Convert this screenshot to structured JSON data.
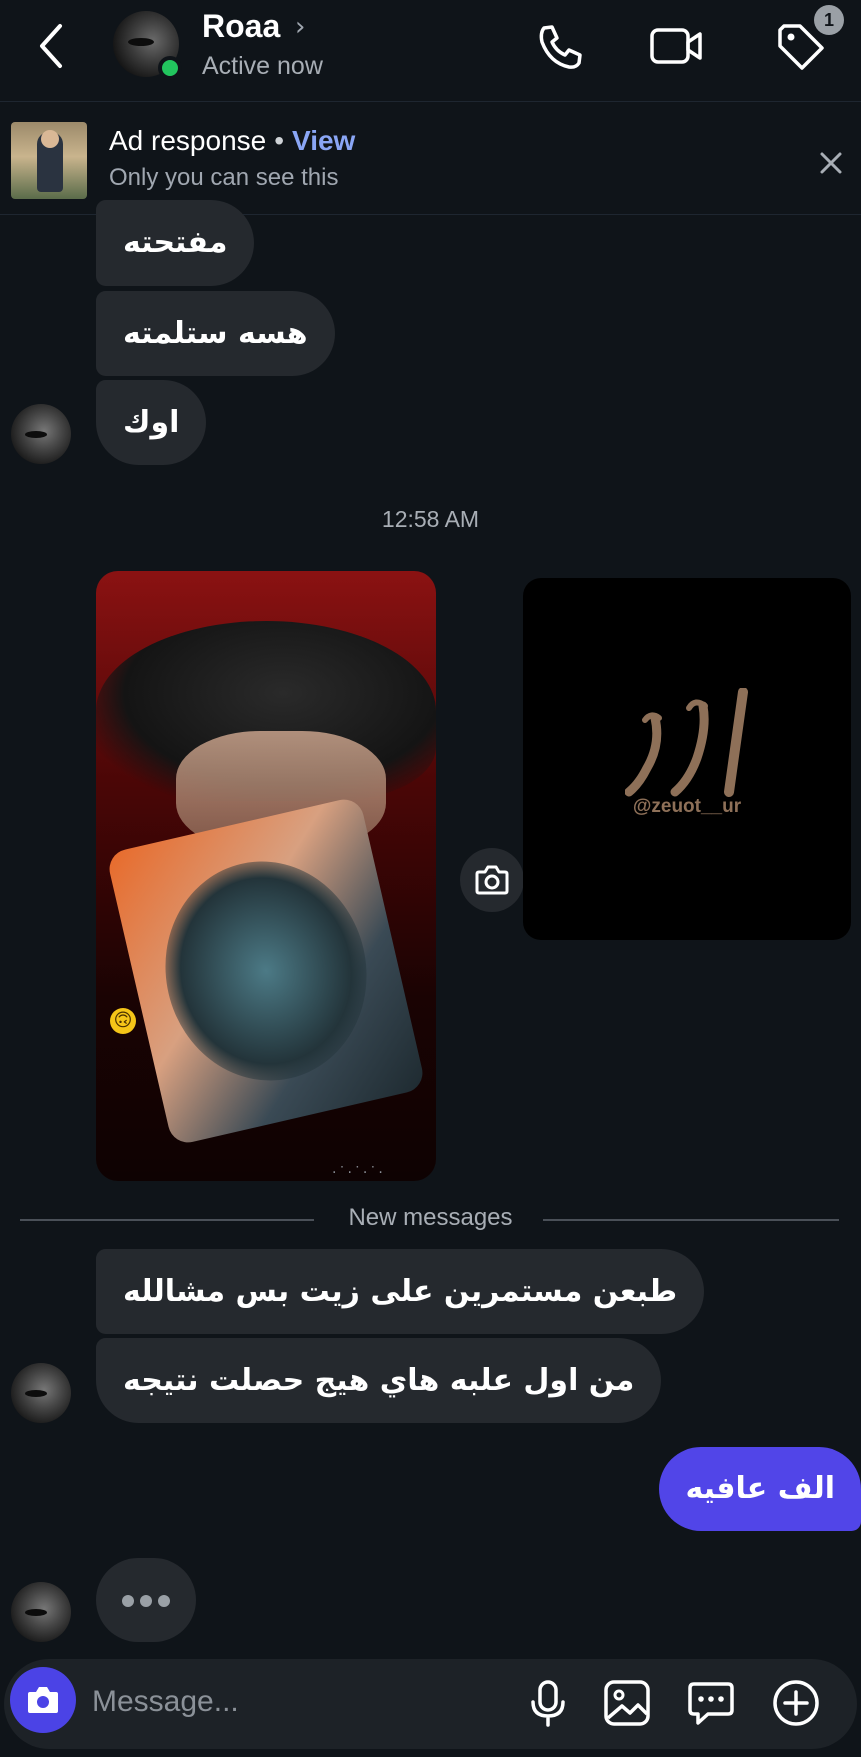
{
  "header": {
    "contact_name": "Roaa",
    "name_chevron": "›",
    "status": "Active now",
    "notification_count": "1",
    "icons": [
      "back-chevron-icon",
      "phone-icon",
      "video-call-icon",
      "tag-icon"
    ]
  },
  "ad_banner": {
    "title": "Ad response",
    "separator": "•",
    "view_link": "View",
    "subtitle": "Only you can see this",
    "icons": [
      "close-icon"
    ]
  },
  "messages_top": [
    {
      "text": "مفتحته"
    },
    {
      "text": "هسه ستلمته"
    },
    {
      "text": "اوك"
    }
  ],
  "timestamp": "12:58 AM",
  "story_card": {
    "handle": "@zeuot__ur"
  },
  "new_messages_label": "New messages",
  "messages_new": [
    {
      "text": "طبعن مستمرين على زيت بس مشالله"
    },
    {
      "text": "من اول علبه هاي هيج حصلت نتيجه"
    }
  ],
  "outgoing_message": "الف عافيه",
  "composer": {
    "placeholder": "Message...",
    "icons": [
      "camera-icon",
      "microphone-icon",
      "image-icon",
      "chat-bubble-icon",
      "add-icon"
    ]
  },
  "colors": {
    "background": "#0f1419",
    "incoming_bubble": "#25292e",
    "outgoing_bubble": "#5145e8",
    "accent_link": "#8aa6f5",
    "online_dot": "#22c55e"
  }
}
